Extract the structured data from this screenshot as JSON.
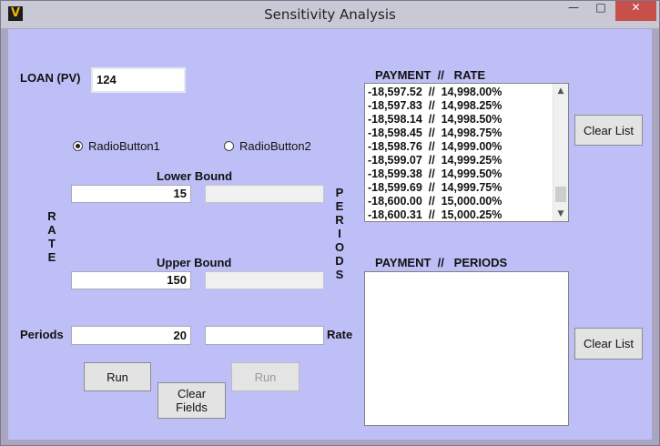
{
  "window": {
    "title": "Sensitivity Analysis",
    "icon": "app-logo-icon",
    "icon_glyph": "V",
    "min_glyph": "—",
    "max_glyph": "□",
    "close_glyph": "✕"
  },
  "loan": {
    "label": "LOAN (PV)",
    "value": "124"
  },
  "radios": [
    {
      "label": "RadioButton1",
      "checked": true
    },
    {
      "label": "RadioButton2",
      "checked": false
    }
  ],
  "rate_label": "R\nA\nT\nE",
  "periods_vertical_label": "P\nE\nR\nI\nO\nD\nS",
  "lower_bound": {
    "label": "Lower Bound",
    "value": "15",
    "right_value": ""
  },
  "upper_bound": {
    "label": "Upper Bound",
    "value": "150",
    "right_value": ""
  },
  "periods": {
    "label": "Periods",
    "value": "20"
  },
  "rate": {
    "label": "Rate",
    "value": ""
  },
  "buttons": {
    "run_left": "Run",
    "run_right": "Run",
    "clear_fields": "Clear\nFields",
    "clear_list_top": "Clear List",
    "clear_list_bottom": "Clear List"
  },
  "payment_rate_list": {
    "header": "PAYMENT  //   RATE",
    "rows": [
      "-18,597.52  //  14,998.00%",
      "-18,597.83  //  14,998.25%",
      "-18,598.14  //  14,998.50%",
      "-18,598.45  //  14,998.75%",
      "-18,598.76  //  14,999.00%",
      "-18,599.07  //  14,999.25%",
      "-18,599.38  //  14,999.50%",
      "-18,599.69  //  14,999.75%",
      "-18,600.00  //  15,000.00%",
      "-18,600.31  //  15,000.25%"
    ],
    "scroll_position": 0.95
  },
  "payment_periods_list": {
    "header": "PAYMENT  //   PERIODS",
    "rows": []
  }
}
